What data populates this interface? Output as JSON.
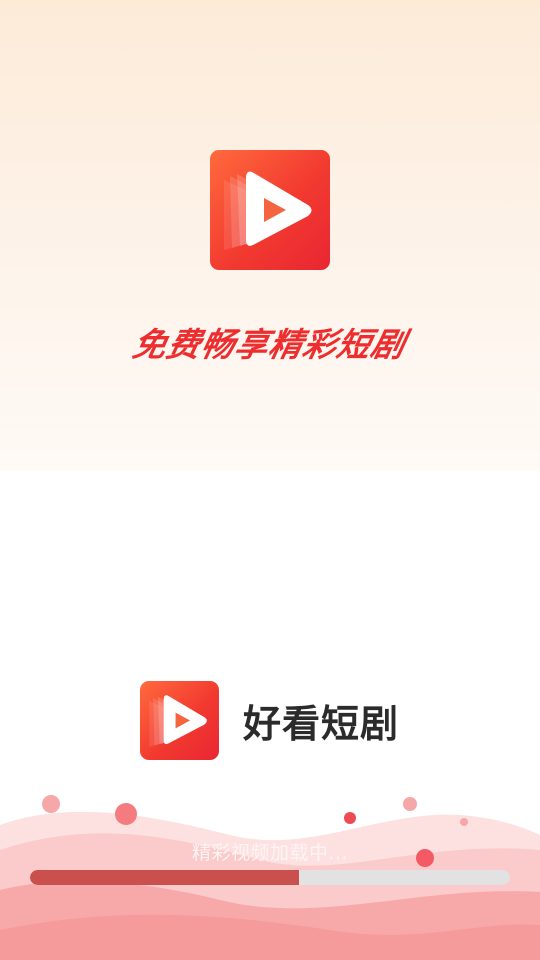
{
  "splash": {
    "slogan": "免费畅享精彩短剧",
    "logo_icon": "play-icon"
  },
  "brand": {
    "app_name": "好看短剧",
    "logo_icon": "play-icon"
  },
  "loading": {
    "text": "精彩视频加载中...",
    "progress": 0.56
  },
  "colors": {
    "brand_red": "#f23a30",
    "slogan_red": "#ee2e2e",
    "progress_fill": "#c9504c",
    "progress_track": "#e2e2e2",
    "top_background": "#fdebd8"
  }
}
